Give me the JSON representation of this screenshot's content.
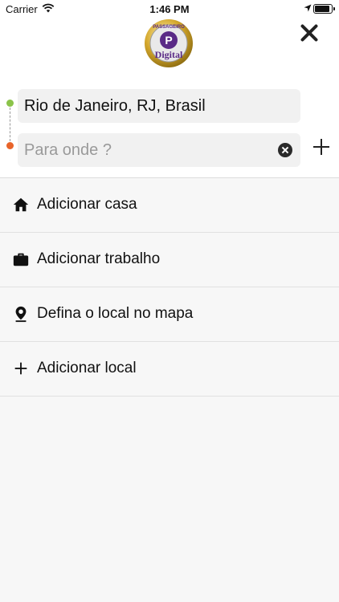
{
  "status_bar": {
    "carrier": "Carrier",
    "time": "1:46 PM"
  },
  "logo": {
    "text_top": "PASSAGEIRO",
    "text_main": "Digital",
    "monogram": "P"
  },
  "route": {
    "origin": "Rio de Janeiro, RJ, Brasil",
    "destination_value": "",
    "destination_placeholder": "Para onde ?"
  },
  "options": [
    {
      "label": "Adicionar casa",
      "icon": "home-icon"
    },
    {
      "label": "Adicionar trabalho",
      "icon": "briefcase-icon"
    },
    {
      "label": "Defina o local no mapa",
      "icon": "location-pin-icon"
    },
    {
      "label": "Adicionar local",
      "icon": "plus-icon"
    }
  ],
  "colors": {
    "origin_dot": "#8bc34a",
    "destination_dot": "#e8642a",
    "logo_gold": "#c9a227",
    "logo_purple": "#5a2a86"
  }
}
